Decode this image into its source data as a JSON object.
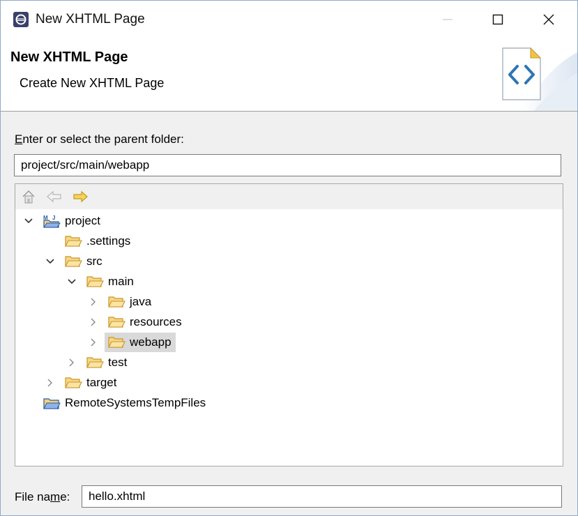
{
  "window": {
    "title": "New XHTML Page",
    "icon": "eclipse-icon"
  },
  "banner": {
    "title": "New XHTML Page",
    "description": "Create New XHTML Page",
    "icon": "xhtml-file-icon"
  },
  "parent_folder": {
    "label_prefix": "E",
    "label_rest": "nter or select the parent folder:",
    "value": "project/src/main/webapp"
  },
  "tree": {
    "toolbar": [
      "home-icon",
      "back-arrow-icon",
      "forward-arrow-icon"
    ],
    "items": [
      {
        "label": "project",
        "state": "expanded",
        "icon": "maven-project-icon"
      },
      {
        "label": ".settings",
        "state": "leaf",
        "icon": "folder-icon"
      },
      {
        "label": "src",
        "state": "expanded",
        "icon": "folder-icon"
      },
      {
        "label": "main",
        "state": "expanded",
        "icon": "folder-icon"
      },
      {
        "label": "java",
        "state": "collapsed",
        "icon": "folder-icon"
      },
      {
        "label": "resources",
        "state": "collapsed",
        "icon": "folder-icon"
      },
      {
        "label": "webapp",
        "state": "collapsed",
        "icon": "folder-icon",
        "selected": true
      },
      {
        "label": "test",
        "state": "collapsed",
        "icon": "folder-icon"
      },
      {
        "label": "target",
        "state": "collapsed",
        "icon": "folder-icon"
      },
      {
        "label": "RemoteSystemsTempFiles",
        "state": "leaf",
        "icon": "remote-project-icon"
      }
    ]
  },
  "file_name": {
    "label_before": "File na",
    "label_underlined": "m",
    "label_after": "e:",
    "value": "hello.xhtml"
  },
  "colors": {
    "folder_fill": "#f7d783",
    "folder_stroke": "#c9952a",
    "selection": "#d9d9d9",
    "forward_arrow": "#e7b12a"
  }
}
